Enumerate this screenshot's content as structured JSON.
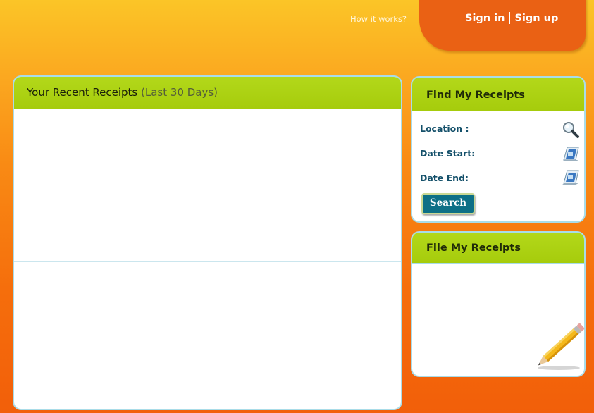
{
  "header": {
    "how_it_works": "How it works?",
    "sign_in": "Sign in",
    "sign_up": "Sign up"
  },
  "recent": {
    "title": "Your Recent Receipts",
    "subtitle": "(Last 30 Days)"
  },
  "find": {
    "title": "Find My Receipts",
    "location_label": "Location :",
    "date_start_label": "Date Start:",
    "date_end_label": "Date End:",
    "search_button": "Search",
    "icons": [
      "magnifier-icon",
      "calendar-icon",
      "calendar-icon"
    ]
  },
  "file": {
    "title": "File My Receipts",
    "icon": "pencil-icon"
  },
  "colors": {
    "header_green": "#a6cc0c",
    "tab_orange": "#ea6114",
    "label_teal": "#14506a",
    "button_teal": "#0d6f86"
  }
}
